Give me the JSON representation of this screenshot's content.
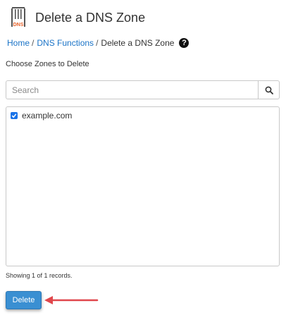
{
  "header": {
    "title": "Delete a DNS Zone",
    "icon": "dns-zone-icon",
    "icon_text": "DNS"
  },
  "breadcrumb": {
    "home": "Home",
    "sep": "/",
    "dns_functions": "DNS Functions",
    "current": "Delete a DNS Zone",
    "help_icon": "question-circle-icon"
  },
  "section_label": "Choose Zones to Delete",
  "search": {
    "placeholder": "Search",
    "value": "",
    "icon": "search-icon"
  },
  "zones": [
    {
      "name": "example.com",
      "checked": true
    }
  ],
  "records_info": "Showing 1 of 1 records.",
  "delete_button": {
    "label": "Delete"
  },
  "colors": {
    "accent": "#3a8fd2",
    "link": "#1a73c7",
    "annotation_arrow": "#e0474c",
    "dns_icon": "#e8632b"
  }
}
